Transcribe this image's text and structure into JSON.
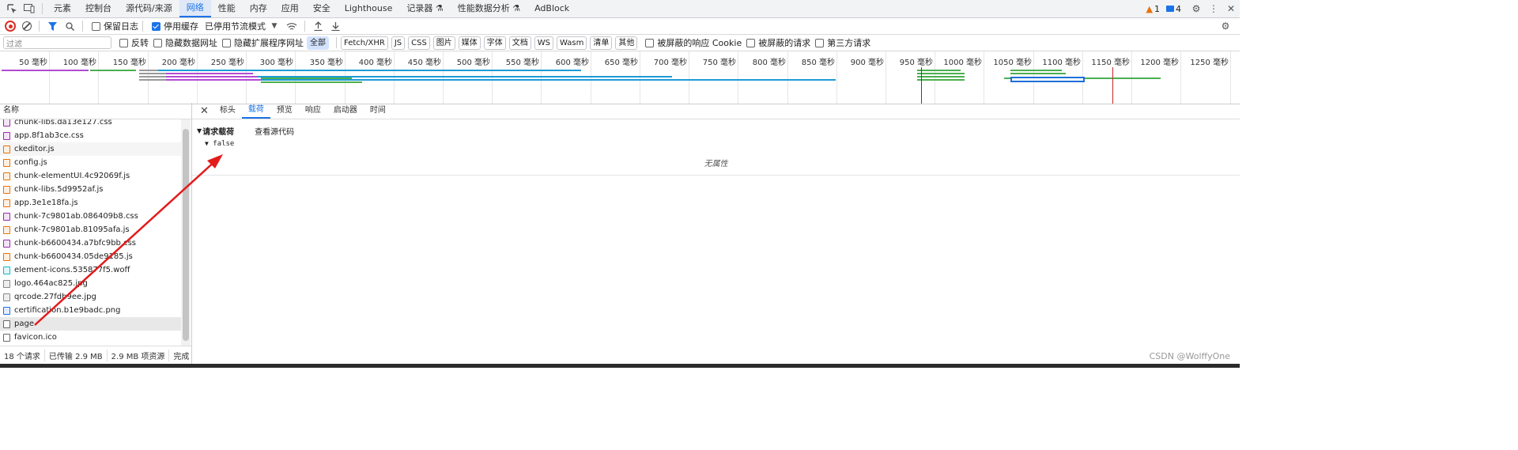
{
  "tabs": [
    "元素",
    "控制台",
    "源代码/来源",
    "网络",
    "性能",
    "内存",
    "应用",
    "安全",
    "Lighthouse",
    "记录器",
    "性能数据分析",
    "AdBlock"
  ],
  "active_tab_index": 3,
  "badges": {
    "warnings": "1",
    "messages": "4"
  },
  "toolbar": {
    "preserve_log": "保留日志",
    "disable_cache": "停用缓存",
    "throttle": "已停用节流模式"
  },
  "filter": {
    "placeholder": "过滤",
    "invert": "反转",
    "hide_data_urls": "隐藏数据网址",
    "hide_ext_urls": "隐藏扩展程序网址",
    "types": [
      "全部",
      "Fetch/XHR",
      "JS",
      "CSS",
      "图片",
      "媒体",
      "字体",
      "文档",
      "WS",
      "Wasm",
      "清单",
      "其他"
    ],
    "blocked_cookies": "被屏蔽的响应 Cookie",
    "blocked_requests": "被屏蔽的请求",
    "third_party": "第三方请求"
  },
  "timeline_ticks": [
    "50 毫秒",
    "100 毫秒",
    "150 毫秒",
    "200 毫秒",
    "250 毫秒",
    "300 毫秒",
    "350 毫秒",
    "400 毫秒",
    "450 毫秒",
    "500 毫秒",
    "550 毫秒",
    "600 毫秒",
    "650 毫秒",
    "700 毫秒",
    "750 毫秒",
    "800 毫秒",
    "850 毫秒",
    "900 毫秒",
    "950 毫秒",
    "1000 毫秒",
    "1050 毫秒",
    "1100 毫秒",
    "1150 毫秒",
    "1200 毫秒",
    "1250 毫秒"
  ],
  "list": {
    "header": "名称",
    "files": [
      {
        "name": "chunk-libs.da13e127.css",
        "type": "css"
      },
      {
        "name": "app.8f1ab3ce.css",
        "type": "css"
      },
      {
        "name": "ckeditor.js",
        "type": "js"
      },
      {
        "name": "config.js",
        "type": "js"
      },
      {
        "name": "chunk-elementUI.4c92069f.js",
        "type": "js"
      },
      {
        "name": "chunk-libs.5d9952af.js",
        "type": "js"
      },
      {
        "name": "app.3e1e18fa.js",
        "type": "js"
      },
      {
        "name": "chunk-7c9801ab.086409b8.css",
        "type": "css"
      },
      {
        "name": "chunk-7c9801ab.81095afa.js",
        "type": "js"
      },
      {
        "name": "chunk-b6600434.a7bfc9bb.css",
        "type": "css"
      },
      {
        "name": "chunk-b6600434.05de9185.js",
        "type": "js"
      },
      {
        "name": "element-icons.535877f5.woff",
        "type": "font"
      },
      {
        "name": "logo.464ac825.jpg",
        "type": "img"
      },
      {
        "name": "qrcode.27fdb9ee.jpg",
        "type": "img"
      },
      {
        "name": "certification.b1e9badc.png",
        "type": "img2"
      },
      {
        "name": "page",
        "type": "doc"
      },
      {
        "name": "favicon.ico",
        "type": "doc"
      }
    ]
  },
  "status": {
    "requests": "18 个请求",
    "transferred": "已传输 2.9 MB",
    "resources": "2.9 MB 项资源",
    "finish": "完成"
  },
  "detail": {
    "tabs": [
      "标头",
      "载荷",
      "预览",
      "响应",
      "启动器",
      "时间"
    ],
    "active_index": 1,
    "section_title": "请求载荷",
    "view_source": "查看源代码",
    "payload_value": "false",
    "no_properties": "无属性"
  },
  "watermark": "CSDN @WolffyOne"
}
